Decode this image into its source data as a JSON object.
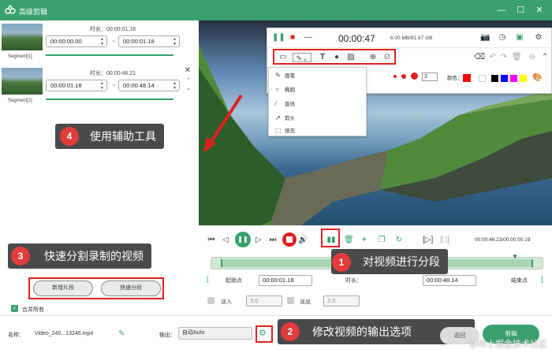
{
  "window": {
    "title": "高级剪辑",
    "minimize": "—",
    "maximize": "☐",
    "close": "✕"
  },
  "segments": [
    {
      "label": "Segment[1]",
      "duration_label": "时长：00:00:01.18",
      "start": "00:00:00.00",
      "end": "00:00:01.18",
      "separator": "~",
      "progress": 1.0
    },
    {
      "label": "Segment[2]",
      "duration_label": "时长：00:00:46.21",
      "start": "00:00:01.18",
      "end": "00:00:48.14",
      "separator": "~",
      "progress": 1.0
    }
  ],
  "annotations": [
    {
      "num": "4",
      "text": "使用辅助工具"
    },
    {
      "num": "3",
      "text": "快速分割录制的视频"
    },
    {
      "num": "1",
      "text": "对视频进行分段"
    },
    {
      "num": "2",
      "text": "修改视频的输出选项"
    }
  ],
  "left_buttons": {
    "new_segment": "新增片段",
    "quick_split": "快速分段",
    "merge_all": "合并所有"
  },
  "recorder": {
    "timer": "00:00:47",
    "size": "6.00 MB/81.67 GB",
    "tools_menu": [
      "画笔",
      "椭圆",
      "直线",
      "箭头",
      "填充"
    ],
    "stroke_size": "3",
    "color_label": "颜色：",
    "colors": [
      "#ff0000",
      "#ffffff",
      "#000000",
      "#0000ff",
      "#ff00ff",
      "#ffff00"
    ]
  },
  "playback": {
    "time": "00:00:46.23/00:00:50.19"
  },
  "cut_row": {
    "start_label": "起始点",
    "start_value": "00:00:01.18",
    "duration_label": "时长：",
    "duration_value": "00:00:48.14",
    "end_label": "结束点"
  },
  "fade": {
    "fade_in_label": "淡入",
    "fade_in_value": "3.0",
    "fade_out_label": "淡出",
    "fade_out_value": "3.0"
  },
  "footer": {
    "name_label": "名称：",
    "file_name": "Video_240...13246.mp4",
    "output_label": "输出：",
    "output_value": "自动Auto",
    "cancel": "返回",
    "clip": "剪辑"
  },
  "watermark": "@稀土掘金技术社区",
  "accent": "#3aa06d"
}
